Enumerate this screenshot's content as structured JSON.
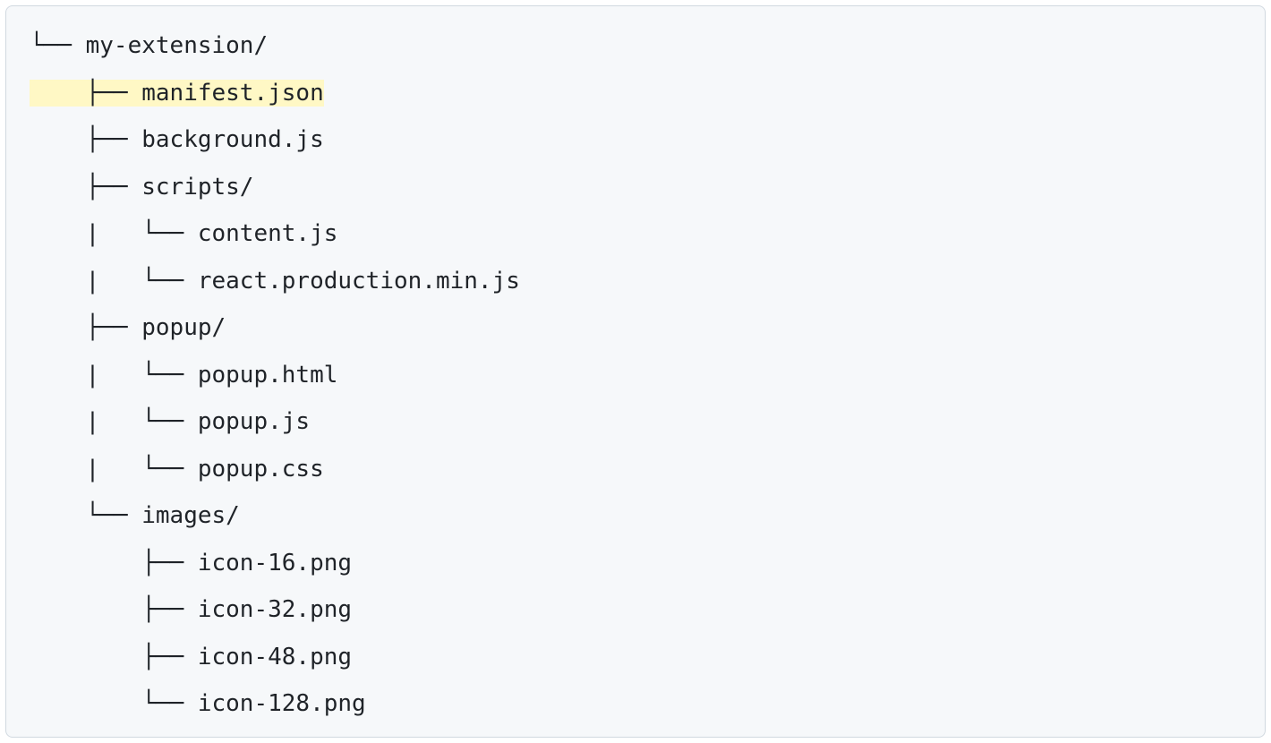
{
  "tree": {
    "lines": [
      {
        "prefix": "└── ",
        "name": "my-extension/",
        "highlighted": false
      },
      {
        "prefix": "    ├── ",
        "name": "manifest.json",
        "highlighted": true
      },
      {
        "prefix": "    ├── ",
        "name": "background.js",
        "highlighted": false
      },
      {
        "prefix": "    ├── ",
        "name": "scripts/",
        "highlighted": false
      },
      {
        "prefix": "    |   └── ",
        "name": "content.js",
        "highlighted": false
      },
      {
        "prefix": "    |   └── ",
        "name": "react.production.min.js",
        "highlighted": false
      },
      {
        "prefix": "    ├── ",
        "name": "popup/",
        "highlighted": false
      },
      {
        "prefix": "    |   └── ",
        "name": "popup.html",
        "highlighted": false
      },
      {
        "prefix": "    |   └── ",
        "name": "popup.js",
        "highlighted": false
      },
      {
        "prefix": "    |   └── ",
        "name": "popup.css",
        "highlighted": false
      },
      {
        "prefix": "    └── ",
        "name": "images/",
        "highlighted": false
      },
      {
        "prefix": "        ├── ",
        "name": "icon-16.png",
        "highlighted": false
      },
      {
        "prefix": "        ├── ",
        "name": "icon-32.png",
        "highlighted": false
      },
      {
        "prefix": "        ├── ",
        "name": "icon-48.png",
        "highlighted": false
      },
      {
        "prefix": "        └── ",
        "name": "icon-128.png",
        "highlighted": false
      }
    ]
  }
}
